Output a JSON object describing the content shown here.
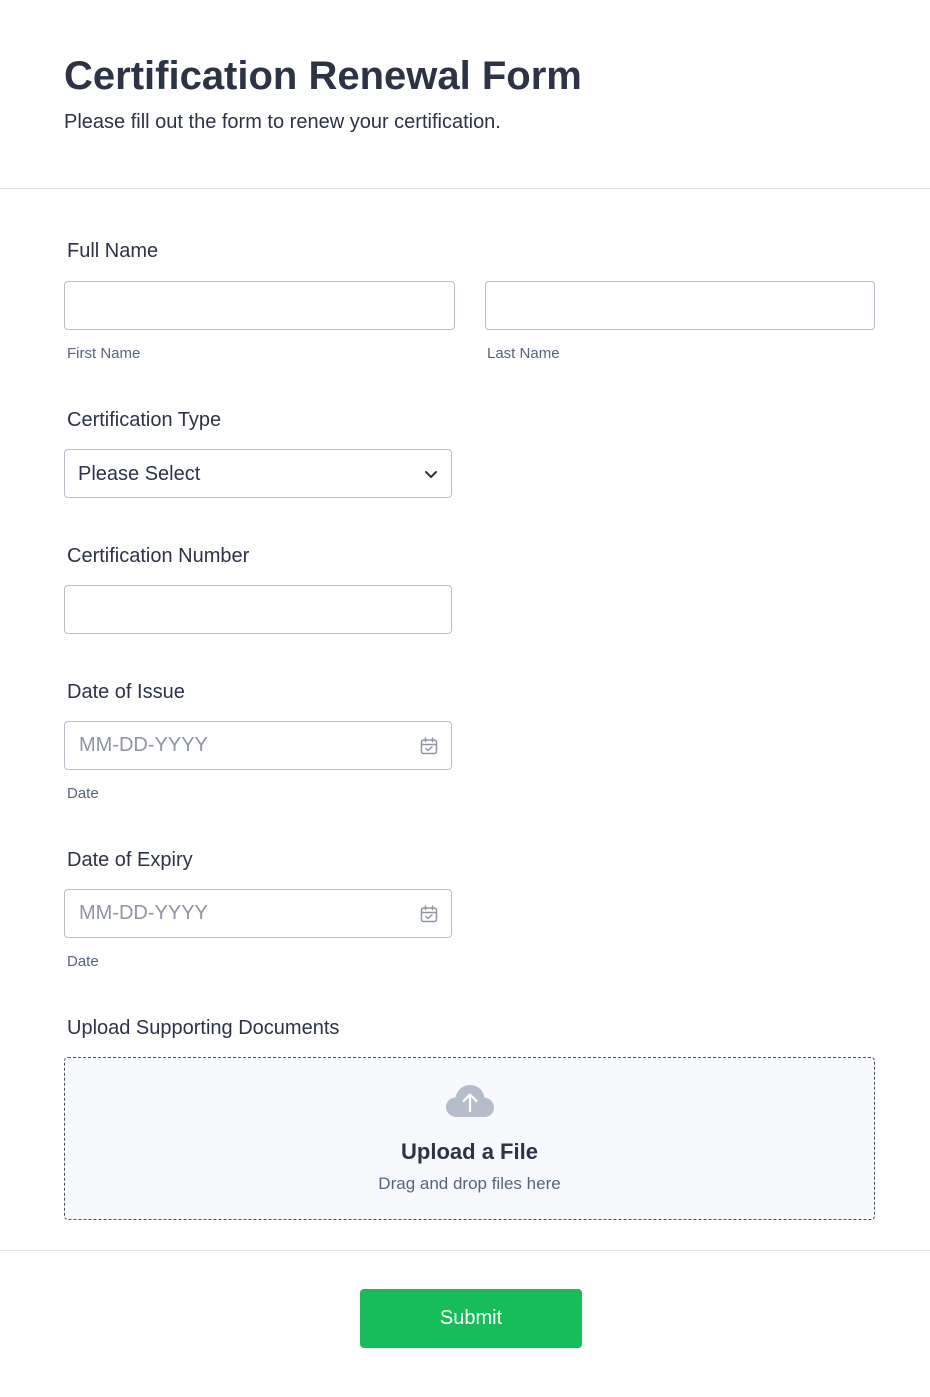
{
  "header": {
    "title": "Certification Renewal Form",
    "subtitle": "Please fill out the form to renew your certification."
  },
  "full_name": {
    "label": "Full Name",
    "first_name": {
      "sublabel": "First Name",
      "value": ""
    },
    "last_name": {
      "sublabel": "Last Name",
      "value": ""
    }
  },
  "certification_type": {
    "label": "Certification Type",
    "selected": "Please Select"
  },
  "certification_number": {
    "label": "Certification Number",
    "value": ""
  },
  "date_of_issue": {
    "label": "Date of Issue",
    "placeholder": "MM-DD-YYYY",
    "sublabel": "Date"
  },
  "date_of_expiry": {
    "label": "Date of Expiry",
    "placeholder": "MM-DD-YYYY",
    "sublabel": "Date"
  },
  "upload": {
    "label": "Upload Supporting Documents",
    "title": "Upload a File",
    "subtitle": "Drag and drop files here",
    "icon": "cloud-upload-icon"
  },
  "submit": {
    "label": "Submit"
  },
  "colors": {
    "text": "#2c3345",
    "border": "#b8bdc9",
    "accent": "#18bd5b",
    "upload_bg": "#f8f9fc"
  }
}
